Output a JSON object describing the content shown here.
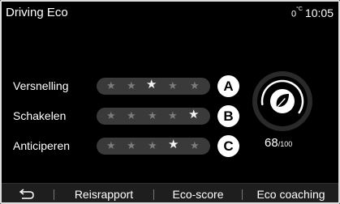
{
  "header": {
    "title": "Driving Eco",
    "temperature": "0",
    "temperature_unit": "°C",
    "time": "10:05"
  },
  "criteria": [
    {
      "label": "Versnelling",
      "stars_filled": 3,
      "stars_total": 5,
      "badge": "A",
      "highlight_star": 3
    },
    {
      "label": "Schakelen",
      "stars_filled": 5,
      "stars_total": 5,
      "badge": "B",
      "highlight_star": 5
    },
    {
      "label": "Anticiperen",
      "stars_filled": 4,
      "stars_total": 5,
      "badge": "C",
      "highlight_star": 4
    }
  ],
  "score": {
    "value": "68",
    "max": "/100",
    "fraction": 0.68,
    "icon": "leaf-icon"
  },
  "footer": {
    "back_icon": "back-arrow-icon",
    "tabs": [
      {
        "label": "Reisrapport"
      },
      {
        "label": "Eco-score"
      },
      {
        "label": "Eco coaching"
      }
    ]
  },
  "colors": {
    "background": "#000000",
    "pill": "#3a3a3a",
    "star_dim": "#7c7c7c",
    "star_on": "#f2f2f2",
    "footer": "#1e1e1e"
  }
}
